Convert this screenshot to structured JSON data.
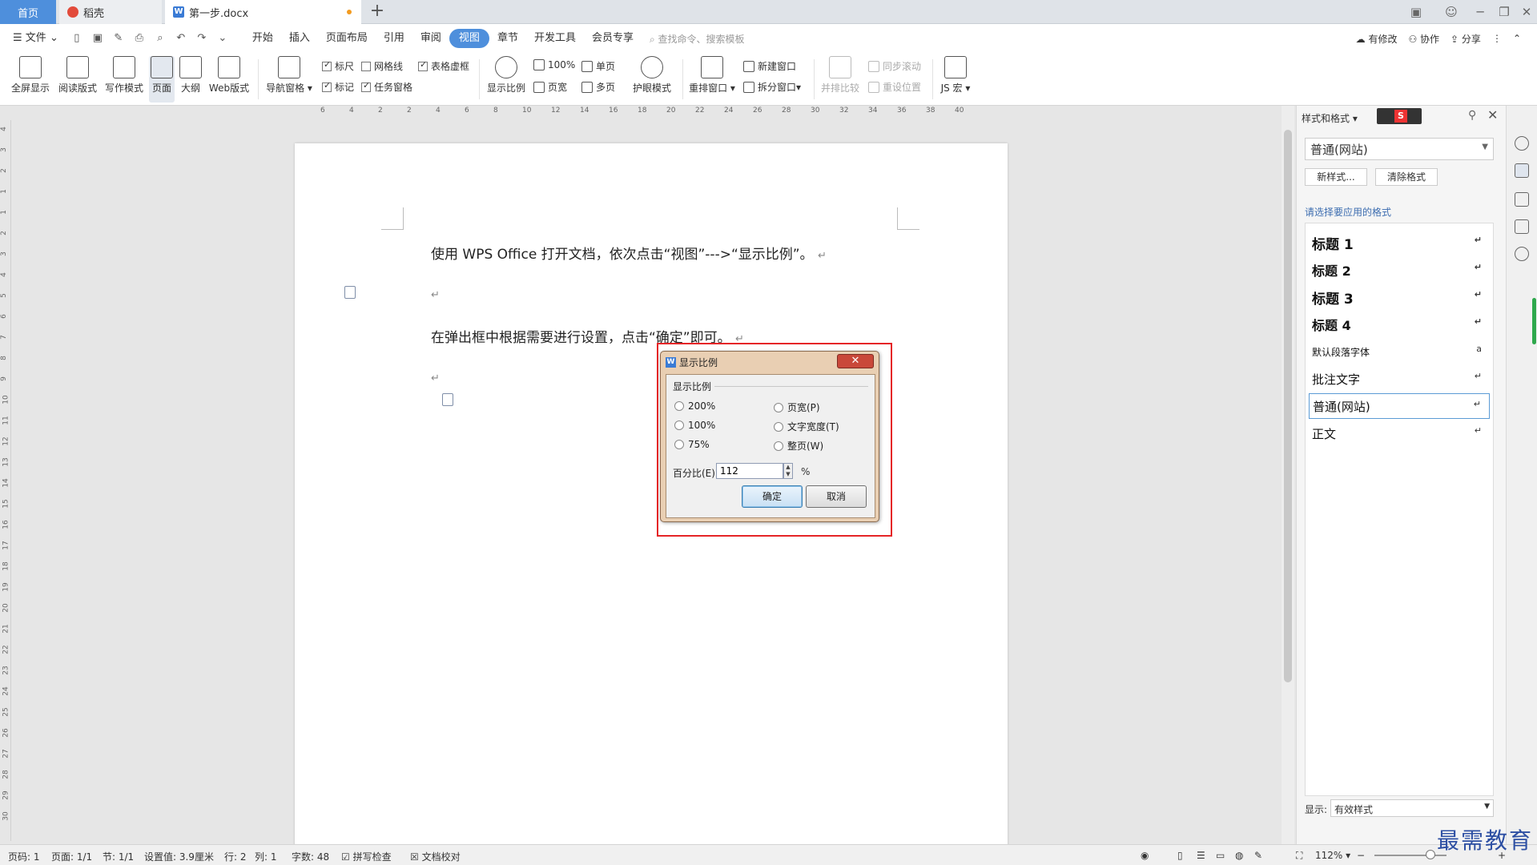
{
  "tabs": {
    "home": "首页",
    "straw": "稻壳",
    "document": "第一步.docx"
  },
  "menubar": {
    "file": "文件",
    "items": [
      "开始",
      "插入",
      "页面布局",
      "引用",
      "审阅",
      "视图",
      "章节",
      "开发工具",
      "会员专享"
    ],
    "active": "视图",
    "search_placeholder": "查找命令、搜索模板",
    "right": [
      "有修改",
      "协作",
      "分享"
    ]
  },
  "ribbon": {
    "fullscreen": "全屏显示",
    "reading": "阅读版式",
    "writing": "写作模式",
    "page": "页面",
    "outline": "大纲",
    "web": "Web版式",
    "nav_pane": "导航窗格",
    "ruler": "标尺",
    "gridlines": "网格线",
    "table_dashed": "表格虚框",
    "marks": "标记",
    "task_pane": "任务窗格",
    "zoom": "显示比例",
    "zoom_100": "100%",
    "single_page": "单页",
    "page_width": "页宽",
    "multi_page": "多页",
    "eye_mode": "护眼模式",
    "rearrange": "重排窗口",
    "new_window": "新建窗口",
    "split_window": "拆分窗口",
    "side_by_side": "并排比较",
    "sync_scroll": "同步滚动",
    "reset_pos": "重设位置",
    "js_macro": "JS 宏"
  },
  "document": {
    "line1": "使用 WPS Office 打开文档，依次点击“视图”--->“显示比例”。",
    "line2": "在弹出框中根据需要进行设置，点击“确定”即可。",
    "para_mark": "↵"
  },
  "dialog": {
    "title": "显示比例",
    "close": "✕",
    "group": "显示比例",
    "options": {
      "p200": "200%",
      "p100": "100%",
      "p75": "75%",
      "page_width": "页宽(P)",
      "text_width": "文字宽度(T)",
      "whole_page": "整页(W)"
    },
    "percent_label": "百分比(E):",
    "percent_value": "112",
    "percent_unit": "%",
    "ok": "确定",
    "cancel": "取消"
  },
  "pane": {
    "title": "样式和格式",
    "current_style": "普通(网站)",
    "new_style": "新样式...",
    "clear_format": "清除格式",
    "prompt": "请选择要应用的格式",
    "styles": [
      "标题 1",
      "标题 2",
      "标题 3",
      "标题 4",
      "默认段落字体",
      "批注文字",
      "普通(网站)",
      "正文"
    ],
    "show_label": "显示:",
    "show_value": "有效样式"
  },
  "statusbar": {
    "page_num": "页码: 1",
    "pages": "页面: 1/1",
    "section": "节: 1/1",
    "setting": "设置值: 3.9厘米",
    "row": "行: 2",
    "col": "列: 1",
    "chars": "字数: 48",
    "spell": "拼写检查",
    "proof": "文档校对",
    "zoom": "112%"
  },
  "watermark": "最需教育",
  "colors": {
    "accent": "#4e8fdc",
    "highlight": "#e52527",
    "dialog_frame": "#e9cfb3"
  }
}
